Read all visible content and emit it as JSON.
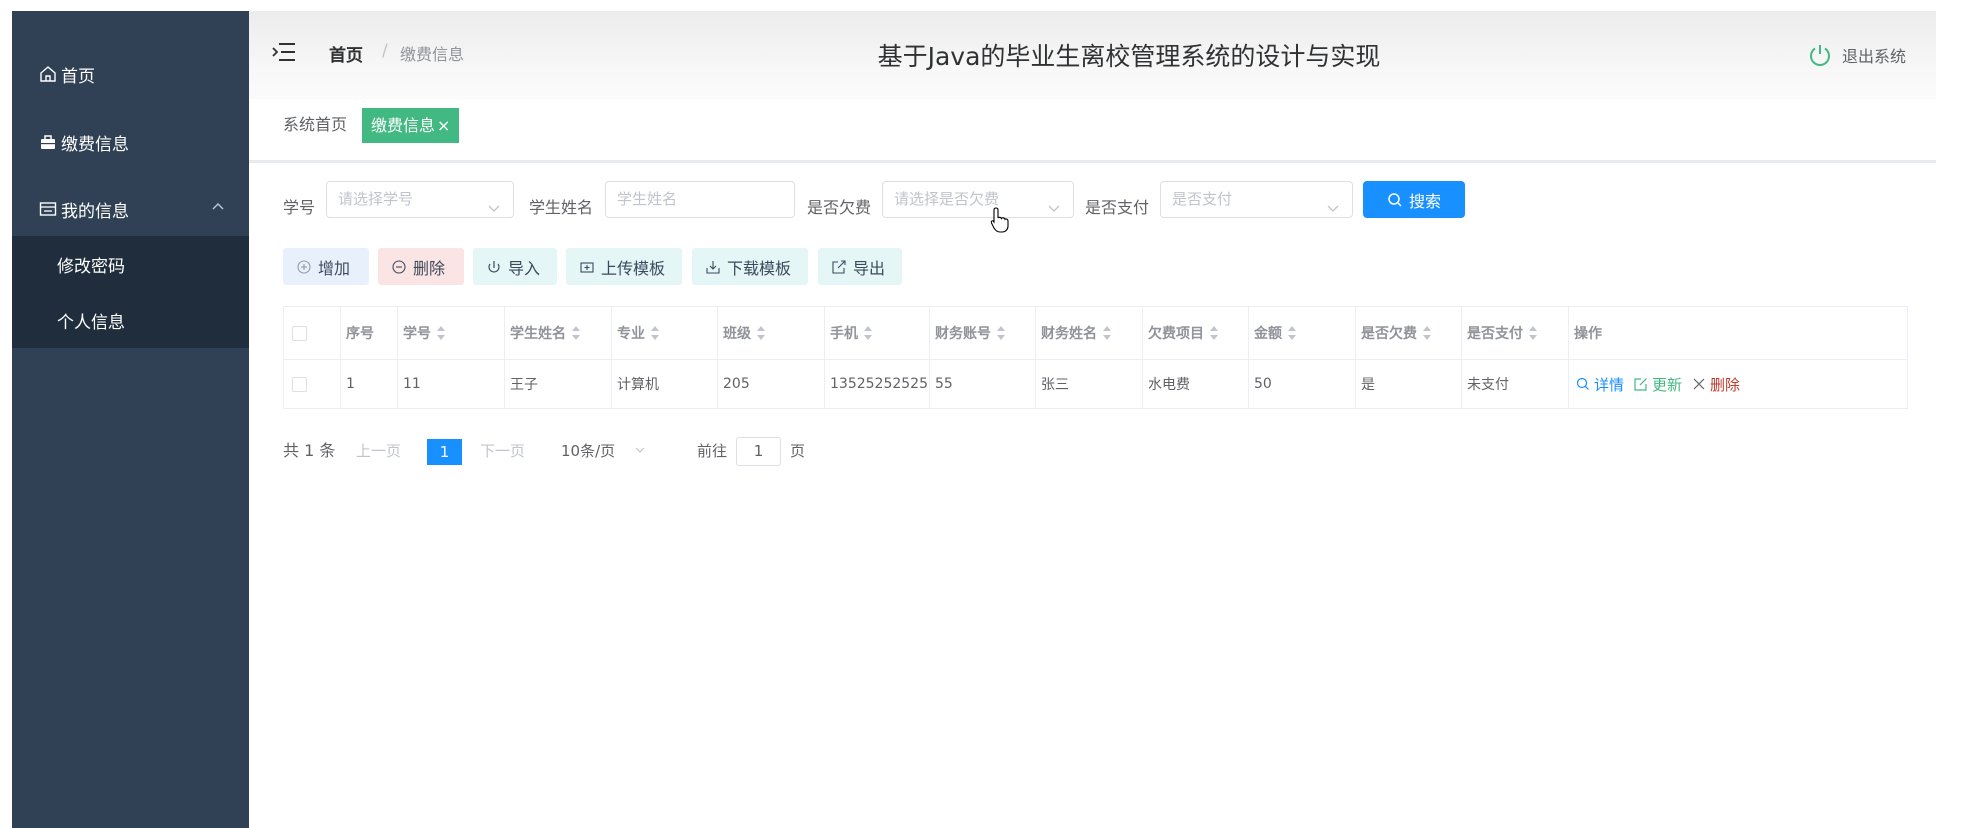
{
  "sidebar": {
    "items": [
      {
        "label": "首页",
        "icon": "home-icon"
      },
      {
        "label": "缴费信息",
        "icon": "briefcase-icon"
      },
      {
        "label": "我的信息",
        "icon": "id-card-icon"
      }
    ],
    "sub_items": [
      {
        "label": "修改密码"
      },
      {
        "label": "个人信息"
      }
    ],
    "bg_color": "#304156"
  },
  "header": {
    "breadcrumb": {
      "home": "首页",
      "separator": "/",
      "current": "缴费信息"
    },
    "title": "基于Java的毕业生离校管理系统的设计与实现",
    "logout_label": "退出系统"
  },
  "tags": {
    "home": "系统首页",
    "active": "缴费信息",
    "active_close": "×",
    "active_color": "#42b983"
  },
  "search": {
    "student_id": {
      "label": "学号",
      "placeholder": "请选择学号"
    },
    "student_name": {
      "label": "学生姓名",
      "placeholder": "学生姓名"
    },
    "in_arrears": {
      "label": "是否欠费",
      "placeholder": "请选择是否欠费"
    },
    "is_paid": {
      "label": "是否支付",
      "placeholder": "是否支付"
    },
    "button_label": "搜索",
    "button_color": "#1890ff"
  },
  "actions": {
    "add": "增加",
    "delete": "删除",
    "import": "导入",
    "upload_template": "上传模板",
    "download_template": "下载模板",
    "export": "导出"
  },
  "table": {
    "columns": [
      "序号",
      "学号",
      "学生姓名",
      "专业",
      "班级",
      "手机",
      "财务账号",
      "财务姓名",
      "欠费项目",
      "金额",
      "是否欠费",
      "是否支付",
      "操作"
    ],
    "rows": [
      {
        "cells": [
          "1",
          "11",
          "王子",
          "计算机",
          "205",
          "13525252525",
          "55",
          "张三",
          "水电费",
          "50",
          "是",
          "未支付"
        ],
        "ops": {
          "detail": "详情",
          "update": "更新",
          "delete": "删除"
        }
      }
    ]
  },
  "pagination": {
    "total": "共 1 条",
    "prev": "上一页",
    "current": "1",
    "next": "下一页",
    "page_size": "10条/页",
    "goto_label": "前往",
    "goto_value": "1",
    "goto_suffix": "页"
  }
}
